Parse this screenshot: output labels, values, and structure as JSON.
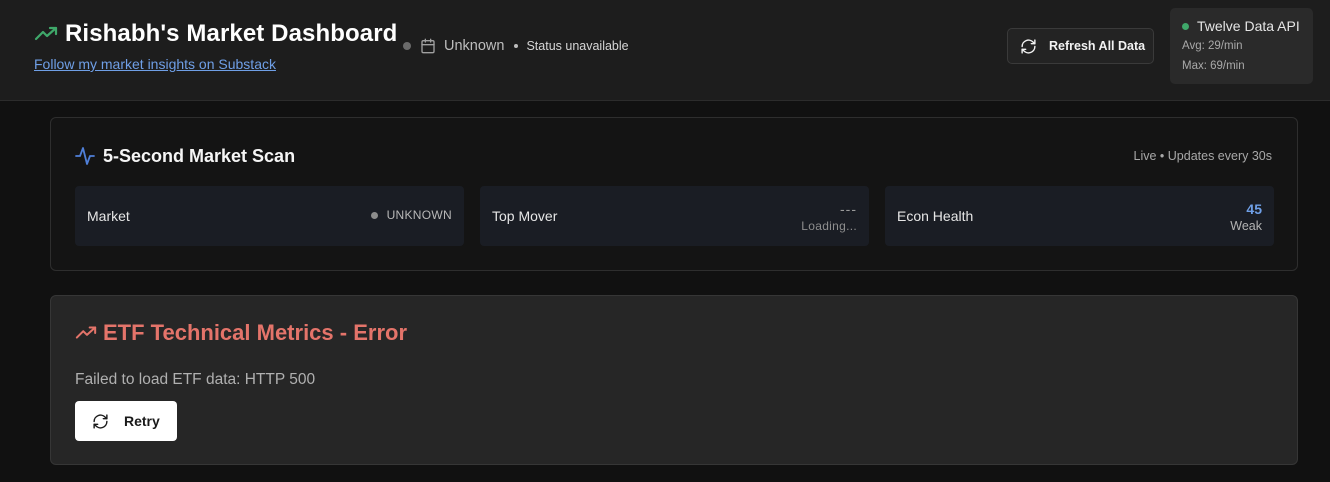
{
  "header": {
    "title": "Rishabh's Market Dashboard",
    "substack_link": "Follow my market insights on Substack",
    "market_date": "Unknown",
    "status": "Status unavailable",
    "refresh_label": "Refresh All Data"
  },
  "api": {
    "name": "Twelve Data API",
    "avg": "Avg: 29/min",
    "max": "Max: 69/min",
    "status_color": "#3fa86a"
  },
  "scan": {
    "title": "5-Second Market Scan",
    "live_label": "Live • Updates every 30s",
    "tiles": [
      {
        "label": "Market",
        "value": "UNKNOWN"
      },
      {
        "label": "Top Mover",
        "value": "---",
        "sub": "Loading..."
      },
      {
        "label": "Econ Health",
        "value": "45",
        "sub": "Weak"
      }
    ]
  },
  "etf": {
    "title": "ETF Technical Metrics - Error",
    "message": "Failed to load ETF data: HTTP 500",
    "retry_label": "Retry"
  },
  "icons": {
    "brand": "trending-up-icon",
    "calendar": "calendar-icon",
    "refresh": "refresh-icon",
    "pulse": "activity-icon",
    "etf": "trending-up-icon",
    "retry": "refresh-icon"
  },
  "colors": {
    "accent_green": "#3fa86a",
    "accent_blue": "#6f9fe6",
    "error_red": "#e4746a",
    "pulse_blue": "#4f7fd8"
  }
}
